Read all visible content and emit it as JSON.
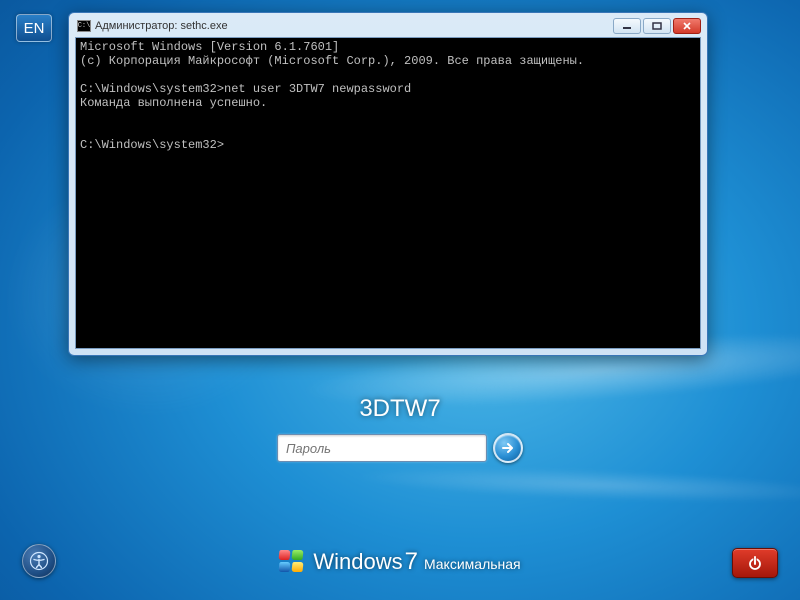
{
  "language_badge": "EN",
  "cmd": {
    "title": "Администратор: sethc.exe",
    "lines": [
      "Microsoft Windows [Version 6.1.7601]",
      "(c) Корпорация Майкрософт (Microsoft Corp.), 2009. Все права защищены.",
      "",
      "C:\\Windows\\system32>net user 3DTW7 newpassword",
      "Команда выполнена успешно.",
      "",
      "",
      "C:\\Windows\\system32>"
    ]
  },
  "login": {
    "username": "3DTW7",
    "password_placeholder": "Пароль"
  },
  "branding": {
    "product": "Windows",
    "version": "7",
    "edition": "Максимальная"
  }
}
